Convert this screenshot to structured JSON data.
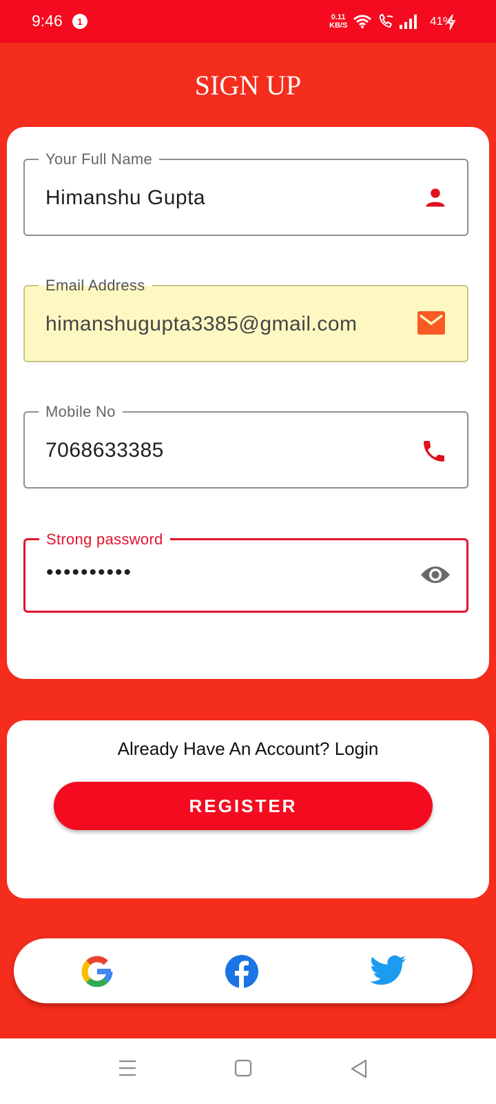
{
  "status_bar": {
    "time": "9:46",
    "notification_count": "1",
    "net_speed_value": "0.11",
    "net_speed_unit": "KB/S",
    "battery_percent": "41%"
  },
  "title": "SIGN UP",
  "form": {
    "full_name": {
      "label": "Your Full Name",
      "value": "Himanshu Gupta",
      "icon": "person-icon"
    },
    "email": {
      "label": "Email Address",
      "value": "himanshugupta3385@gmail.com",
      "icon": "mail-icon"
    },
    "mobile": {
      "label": "Mobile No",
      "value": "7068633385",
      "icon": "phone-icon"
    },
    "password": {
      "label": "Strong password",
      "value": "••••••••••",
      "icon": "eye-icon"
    }
  },
  "actions": {
    "login_text": "Already Have An Account? Login",
    "register_label": "REGISTER"
  },
  "social": [
    "google-icon",
    "facebook-icon",
    "twitter-icon"
  ],
  "colors": {
    "primary": "#f40b1f",
    "background": "#f42d1d",
    "autofill": "#fdf8c2",
    "focus": "#e0142c"
  }
}
